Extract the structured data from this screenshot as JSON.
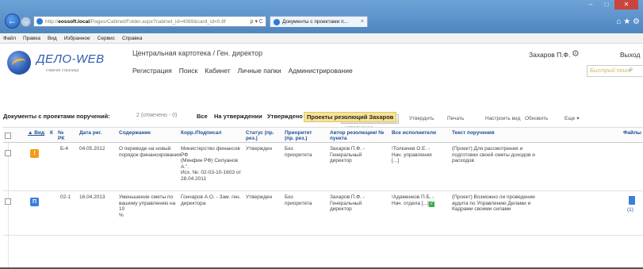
{
  "browser": {
    "url_prefix": "http://",
    "url_host": "eossoft.local",
    "url_path": "/Pages/Cabinet/Folder.aspx?cabinet_id=4089&card_id=0.8f",
    "tab_title": "Документы с проектами п...",
    "nav_back": "←",
    "nav_forward": "→",
    "tools_glyph": "ρ ▾ C",
    "menu": [
      "Файл",
      "Правка",
      "Вид",
      "Избранное",
      "Сервис",
      "Справка"
    ],
    "right_tools": "⌂ ★ ⚙",
    "window_buttons": [
      "–",
      "□",
      "✕"
    ]
  },
  "header": {
    "logo_text": "ДЕЛО-WEB",
    "logo_sub": "главная страница",
    "card_title": "Центральная картотека / Ген. директор",
    "nav_links": [
      "Регистрация",
      "Поиск",
      "Кабинет",
      "Личные папки",
      "Администрирование"
    ],
    "user_name": "Захаров П.Ф.",
    "gear_glyph": "⚙",
    "exit_label": "Выход",
    "quick_search_placeholder": "Быстрый поиск",
    "search_glyph": "⌕"
  },
  "toolbar": {
    "send_to_execution": "Направить на исполнение",
    "approve": "Утвердить",
    "print": "Печать",
    "configure_view": "Настроить вид",
    "refresh": "Обновить",
    "more": "Еще"
  },
  "filter": {
    "title": "Документы с проектами поручений:",
    "count": "2 (отмечено - 0)",
    "tabs": [
      "Все",
      "На утверждении",
      "Утверждено",
      "Проекты резолюций Захаров"
    ],
    "active_tab": "Проекты резолюций Захаров"
  },
  "table": {
    "headers": {
      "view": "▲ Вид",
      "k": "К",
      "reg_no": "№ РК",
      "reg_date": "Дата рег.",
      "content": "Содержание",
      "corr": "Корр./Подписал",
      "status": "Статус (пр. рез.)",
      "priority": "Приоритет (пр. рез.)",
      "author": "Автор резолюции/ № пункта",
      "executors": "Все исполнители",
      "text": "Текст поручения",
      "files": "Файлы"
    },
    "rows": [
      {
        "badge": "!",
        "badge_color": "#f39c1c",
        "reg_no": "Б-4",
        "reg_date": "04.05.2012",
        "content": "О переводе на новый\nпорядок финансирования",
        "corr": "Министерство финансов РФ\n(Минфин РФ) Силуанов\nА.\".\nИсх. №: 02-03-10-1603 от\n28.04.2011",
        "status": "Утвержден",
        "priority": "Без\nприоритета",
        "author": "Захаров П.Ф. -\nГенеральный\nдиректор",
        "executor_name": "Толкачев О.Е. -",
        "executor_rest": "Нач. управления\n[...]",
        "text": "(Проект) Для рассмотрения и\nподготовки своей сметы доходов и\nрасходов",
        "files": ""
      },
      {
        "badge": "П",
        "badge_color": "#3d7edc",
        "reg_no": "02-1",
        "reg_date": "16.04.2013",
        "content": "Уменьшение сметы по\nвашему управлению на 10\n%",
        "corr": "Гончаров А.О. - Зам. ген.\nдиректора",
        "status": "Утвержден",
        "priority": "Без\nприоритета",
        "author": "Захаров П.Ф. -\nГенеральный\nдиректор",
        "executor_name": "Адаменков П.Б. -",
        "executor_rest": "Нач. отдела [...]",
        "text": "(Проект) Возможно ли проведение\nаудита по Управлению Делами и\nКадрами своими силами",
        "files": "(1)"
      }
    ]
  },
  "colors": {
    "accent": "#2a5ab0",
    "header_link": "#1d4f98",
    "active_tab_bg": "#f6e39a",
    "badge_orange": "#f39c1c",
    "badge_blue": "#3d7edc",
    "ok_green": "#3fae49"
  }
}
